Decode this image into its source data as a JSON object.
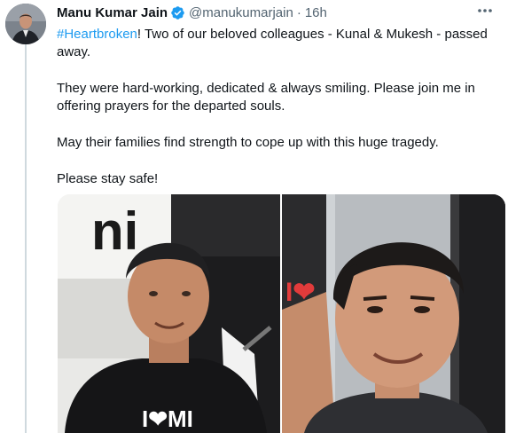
{
  "tweet": {
    "author": {
      "display_name": "Manu Kumar Jain",
      "handle": "@manukumarjain",
      "verified": true,
      "avatar_icon": "person-avatar"
    },
    "separator": "·",
    "time": "16h",
    "more_icon": "more-dots-icon",
    "text": {
      "hashtag": "#Heartbroken",
      "line1_rest": "! Two of our beloved colleagues - Kunal & Mukesh - passed away.",
      "paragraph2": "They were hard-working, dedicated & always smiling. Please join me in offering prayers for the departed souls.",
      "paragraph3": "May their families find strength to cope up with this huge tragedy.",
      "paragraph4": "Please stay safe!"
    },
    "media": {
      "left_photo_text": "ni",
      "left_shirt_text": "I❤MI",
      "right_photo_text": "I❤"
    },
    "colors": {
      "link": "#1d9bf0",
      "secondary_text": "#536471",
      "verified_badge": "#1d9bf0"
    }
  }
}
